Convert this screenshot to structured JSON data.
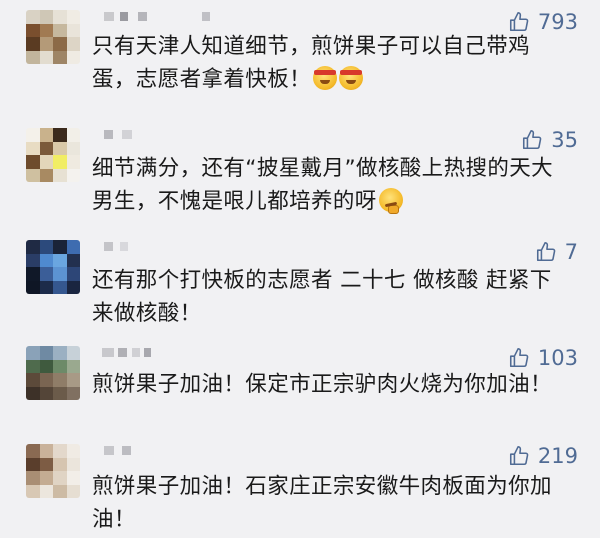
{
  "comments": [
    {
      "likes": "793",
      "text": "只有天津人知道细节，煎饼果子可以自己带鸡蛋，志愿者拿着快板！",
      "emojis": [
        "clapperboard-headband-emoji",
        "clapperboard-headband-emoji"
      ],
      "avatar_colors": [
        "#d9d2c4",
        "#cfc7b6",
        "#e6e1d6",
        "#f0ece4",
        "#7a4f2e",
        "#a17a52",
        "#c6b89e",
        "#e9e4da",
        "#5a3b22",
        "#b49a78",
        "#8c6a47",
        "#ddd5c6",
        "#c2b59c",
        "#e2dccf",
        "#9e8566",
        "#efebe3"
      ]
    },
    {
      "likes": "35",
      "text": "细节满分，还有“披星戴月”做核酸上热搜的天大男生，不愧是哏儿都培养的呀",
      "emojis": [
        "thinking-emoji"
      ],
      "avatar_colors": [
        "#f4f1ea",
        "#c9b28c",
        "#3b2a1c",
        "#f2efe8",
        "#e8dcc3",
        "#7b5a3a",
        "#d9c9a8",
        "#eae6dc",
        "#6e4c2c",
        "#e3d6ba",
        "#f1ed64",
        "#efeae0",
        "#cfc0a0",
        "#a88a62",
        "#e7e1d3",
        "#f4f2ee"
      ]
    },
    {
      "likes": "7",
      "text": "还有那个打快板的志愿者 二十七 做核酸 赶紧下来做核酸！",
      "emojis": [],
      "avatar_colors": [
        "#1f2a44",
        "#2c4a7c",
        "#1a2338",
        "#3e6cb0",
        "#2a3d66",
        "#4f8ad0",
        "#6aa6e0",
        "#22304f",
        "#101828",
        "#3b5e98",
        "#5c93d2",
        "#2d4677",
        "#0f1625",
        "#1c2b4a",
        "#35578f",
        "#1a2540"
      ]
    },
    {
      "likes": "103",
      "text": "煎饼果子加油！保定市正宗驴肉火烧为你加油！",
      "emojis": [],
      "avatar_colors": [
        "#8aa2b8",
        "#6f8aa3",
        "#9bb0c2",
        "#c7d1d8",
        "#4f6b4d",
        "#3f5a3e",
        "#6d8a68",
        "#9aa98f",
        "#5c4a3a",
        "#7a6552",
        "#8f7d68",
        "#a89a86",
        "#3d3128",
        "#544538",
        "#6b5b4a",
        "#807061"
      ]
    },
    {
      "likes": "219",
      "text": "煎饼果子加油！石家庄正宗安徽牛肉板面为你加油！",
      "emojis": [],
      "avatar_colors": [
        "#8a6a52",
        "#c9b29a",
        "#e3d8cb",
        "#f0ebe4",
        "#5a3e2c",
        "#7d5c44",
        "#d6c5b0",
        "#ebe5dc",
        "#a98e74",
        "#c4ac92",
        "#e0d4c4",
        "#f2eee8",
        "#d8c8b4",
        "#ece6dd",
        "#cdbba4",
        "#e6ded2"
      ]
    }
  ],
  "colors": {
    "background": "#f1f1f3",
    "like_accent": "#506b94",
    "text": "#1a1a1a"
  }
}
